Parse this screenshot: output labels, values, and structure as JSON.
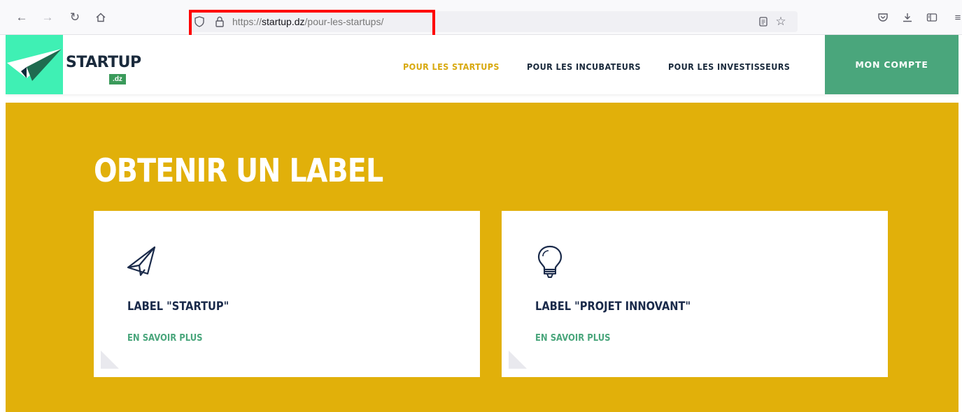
{
  "browser": {
    "url_scheme": "https://",
    "url_host": "startup.dz",
    "url_path": "/pour-les-startups/"
  },
  "site": {
    "logo_text": "STARTUP",
    "logo_suffix": ".dz",
    "menu": [
      {
        "label": "POUR LES STARTUPS",
        "active": true
      },
      {
        "label": "POUR LES INCUBATEURS",
        "active": false
      },
      {
        "label": "POUR LES INVESTISSEURS",
        "active": false
      }
    ],
    "account_button": "MON COMPTE"
  },
  "hero": {
    "title": "OBTENIR UN LABEL",
    "cards": [
      {
        "title": "LABEL \"STARTUP\"",
        "link": "EN SAVOIR PLUS",
        "icon": "paper-plane-icon"
      },
      {
        "title": "LABEL \"PROJET INNOVANT\"",
        "link": "EN SAVOIR PLUS",
        "icon": "lightbulb-icon"
      }
    ]
  },
  "colors": {
    "hero_background": "#e1b00a",
    "accent_green": "#4aa67c",
    "logo_mint": "#3ff0b4",
    "active_menu": "#d8a90f",
    "navy_text": "#1a2a4a",
    "highlight_box": "#ff0000"
  }
}
